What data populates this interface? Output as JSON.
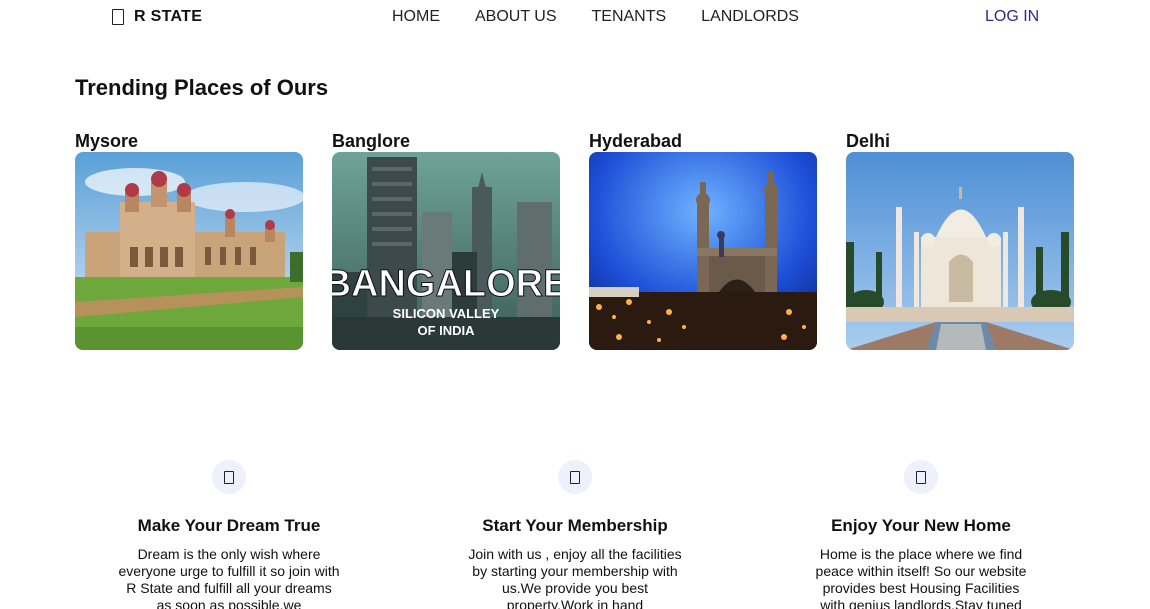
{
  "nav": {
    "brand": "R STATE",
    "links": [
      "HOME",
      "ABOUT US",
      "TENANTS",
      "LANDLORDS"
    ],
    "login": "LOG IN"
  },
  "trending": {
    "title": "Trending Places of Ours",
    "places": [
      {
        "name": "Mysore",
        "image": "mysore-palace-image"
      },
      {
        "name": "Banglore",
        "image": "bangalore-skyline-image",
        "overlay_title": "BANGALORE",
        "overlay_sub1": "SILICON VALLEY",
        "overlay_sub2": "OF INDIA"
      },
      {
        "name": "Hyderabad",
        "image": "charminar-image"
      },
      {
        "name": "Delhi",
        "image": "taj-mahal-image"
      }
    ]
  },
  "features": [
    {
      "title": "Make Your Dream True",
      "text": "Dream is the only wish where everyone urge to fulfill it so join with R State and fulfill all your dreams as soon as possible.we",
      "icon": "document-icon"
    },
    {
      "title": "Start Your Membership",
      "text": "Join with us , enjoy all the facilities by starting your membership with us.We provide you best property.Work in hand",
      "icon": "document-icon"
    },
    {
      "title": "Enjoy Your New Home",
      "text": "Home is the place where we find peace within itself! So our website provides best Housing Facilities with genius landlords.Stay tuned",
      "icon": "document-icon"
    }
  ],
  "colors": {
    "login": "#2b2b8c",
    "icon_bg": "#eef1fb"
  }
}
